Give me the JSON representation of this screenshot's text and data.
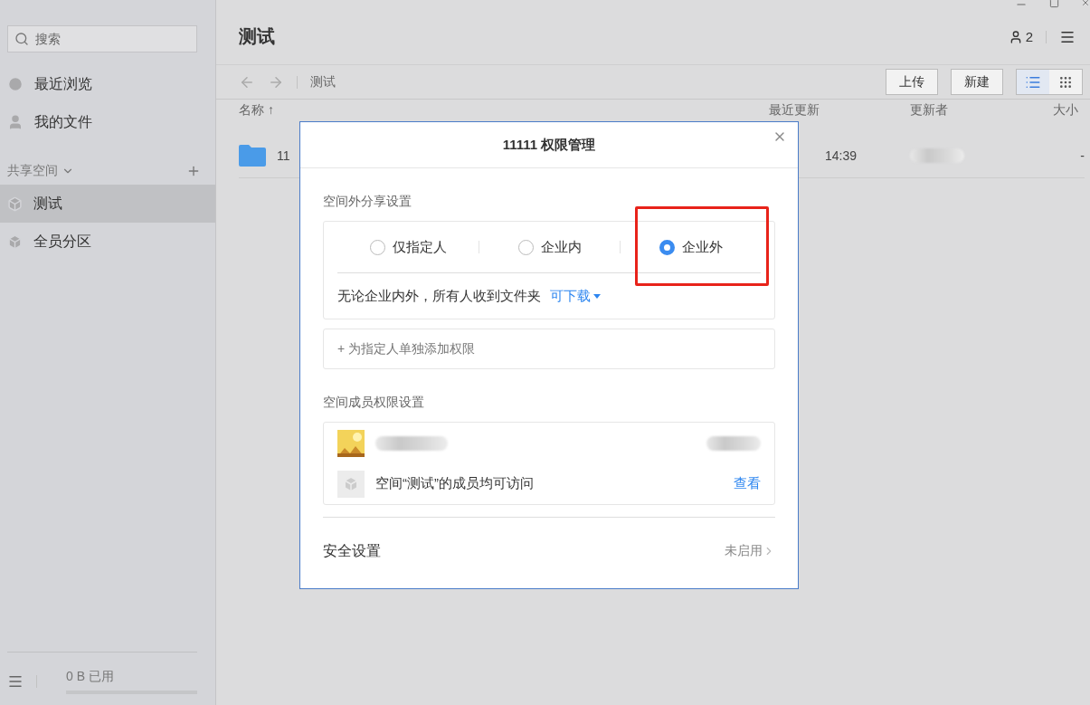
{
  "sidebar": {
    "search": {
      "placeholder": "搜索"
    },
    "nav": [
      {
        "kind": "recent",
        "label": "最近浏览"
      },
      {
        "kind": "files",
        "label": "我的文件"
      }
    ],
    "shared": {
      "title": "共享空间",
      "items": [
        {
          "label": "测试",
          "selected": true
        },
        {
          "label": "全员分区",
          "selected": false
        }
      ]
    },
    "usage": {
      "text": "0 B 已用"
    }
  },
  "main": {
    "title": "测试",
    "member_count": "2",
    "breadcrumb": "测试",
    "buttons": [
      "上传",
      "新建"
    ],
    "view_modes": [
      {
        "kind": "list",
        "selected": true
      },
      {
        "kind": "grid",
        "selected": false
      }
    ],
    "table": {
      "columns": [
        {
          "label": "名称",
          "sort_mark": "↑"
        },
        {
          "label": "最近更新"
        },
        {
          "label": "更新者"
        },
        {
          "label": "大小"
        }
      ],
      "rows": [
        {
          "name": "11",
          "updated": "14:39",
          "size": "-"
        }
      ]
    }
  },
  "dialog": {
    "title": "11111 权限管理",
    "external_share": {
      "label": "空间外分享设置",
      "options": [
        {
          "label": "仅指定人",
          "selected": false
        },
        {
          "label": "企业内",
          "selected": false
        },
        {
          "label": "企业外",
          "selected": true
        }
      ],
      "description": "无论企业内外，所有人收到文件夹",
      "permission": "可下载"
    },
    "add_permission": "+ 为指定人单独添加权限",
    "members": {
      "label": "空间成员权限设置",
      "space_access": "空间“测试”的成员均可访问",
      "view_link": "查看"
    },
    "security": {
      "label": "安全设置",
      "status": "未启用"
    }
  }
}
